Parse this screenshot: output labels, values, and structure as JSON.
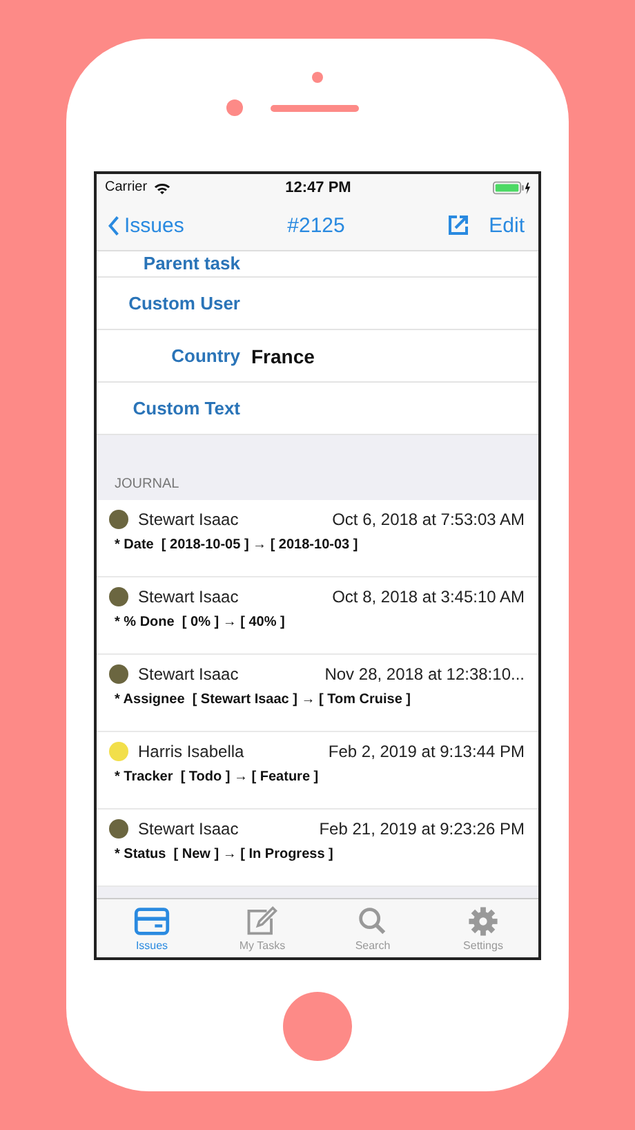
{
  "status_bar": {
    "carrier": "Carrier",
    "time": "12:47 PM"
  },
  "nav": {
    "back": "Issues",
    "title": "#2125",
    "action": "Edit"
  },
  "fields": [
    {
      "label": "Parent task"
    },
    {
      "label": "Custom User"
    },
    {
      "label": "Country",
      "value": "France"
    },
    {
      "label": "Custom Text"
    }
  ],
  "journal": {
    "title": "JOURNAL",
    "entries": [
      {
        "author": "Stewart Isaac",
        "time": "Oct 6, 2018 at 7:53:03 AM",
        "change": "* Date  [ 2018-10-05 ] → [ 2018-10-03 ]",
        "color": "#6b6640"
      },
      {
        "author": "Stewart Isaac",
        "time": "Oct 8, 2018 at 3:45:10 AM",
        "change": "* % Done  [ 0% ] → [ 40% ]",
        "color": "#6b6640"
      },
      {
        "author": "Stewart Isaac",
        "time": "Nov 28, 2018 at 12:38:10...",
        "change": "* Assignee  [ Stewart Isaac ] → [ Tom Cruise ]",
        "color": "#6b6640"
      },
      {
        "author": "Harris Isabella",
        "time": "Feb 2, 2019 at 9:13:44 PM",
        "change": "* Tracker  [ Todo ] → [ Feature ]",
        "color": "#f2df4a"
      },
      {
        "author": "Stewart Isaac",
        "time": "Feb 21, 2019 at 9:23:26 PM",
        "change": "* Status  [ New ] → [ In Progress ]",
        "color": "#6b6640"
      }
    ]
  },
  "tabs": [
    {
      "label": "Issues",
      "kind": "card",
      "selected": true
    },
    {
      "label": "My Tasks",
      "kind": "edit",
      "selected": false
    },
    {
      "label": "Search",
      "kind": "search",
      "selected": false
    },
    {
      "label": "Settings",
      "kind": "gear",
      "selected": false
    }
  ]
}
